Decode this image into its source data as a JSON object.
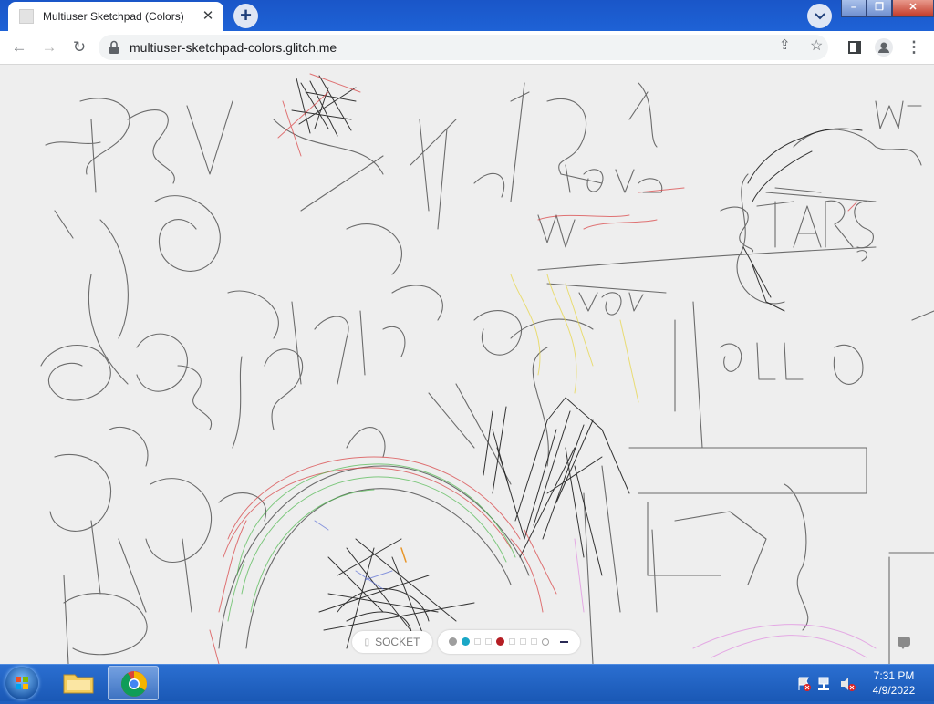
{
  "browser": {
    "tab_title": "Multiuser Sketchpad (Colors)",
    "tab_close": "✕",
    "new_tab": "+",
    "tab_search": "⌄",
    "url": "multiuser-sketchpad-colors.glitch.me",
    "window_controls": [
      "–",
      "❐",
      "✕"
    ]
  },
  "toolbar": {
    "back": "←",
    "forward": "→",
    "reload": "↻",
    "share": "⇪",
    "star": "☆",
    "side_panel": "▯",
    "profile": "●",
    "menu": "⋮"
  },
  "sketchpad": {
    "socket_label": "SOCKET",
    "socket_icon": "plug-icon",
    "palette": [
      {
        "name": "gray",
        "color": "#9e9e9e",
        "shape": "dot"
      },
      {
        "name": "teal",
        "color": "#1aa7c6",
        "shape": "dot",
        "selected": true
      },
      {
        "name": "empty-1",
        "color": "#d6d6d6",
        "shape": "square"
      },
      {
        "name": "empty-2",
        "color": "#d6d6d6",
        "shape": "square"
      },
      {
        "name": "red",
        "color": "#b51e24",
        "shape": "dot"
      },
      {
        "name": "empty-3",
        "color": "#d6d6d6",
        "shape": "square"
      },
      {
        "name": "empty-4",
        "color": "#d6d6d6",
        "shape": "square"
      },
      {
        "name": "empty-5",
        "color": "#d6d6d6",
        "shape": "square"
      },
      {
        "name": "empty-6",
        "color": "#d6d6d6",
        "shape": "circle"
      },
      {
        "name": "stroke-size",
        "color": "#2a2a55",
        "shape": "line"
      }
    ],
    "ink_colors": {
      "pencil": "#555555",
      "dark": "#1e1e1e",
      "red": "#d9484a",
      "green": "#4fb84f",
      "yellow": "#e7d64a",
      "pink": "#e08adf",
      "blue": "#5b6fd6"
    }
  },
  "taskbar": {
    "time": "7:31 PM",
    "date": "4/9/2022",
    "apps": [
      "file-explorer",
      "chrome"
    ]
  }
}
